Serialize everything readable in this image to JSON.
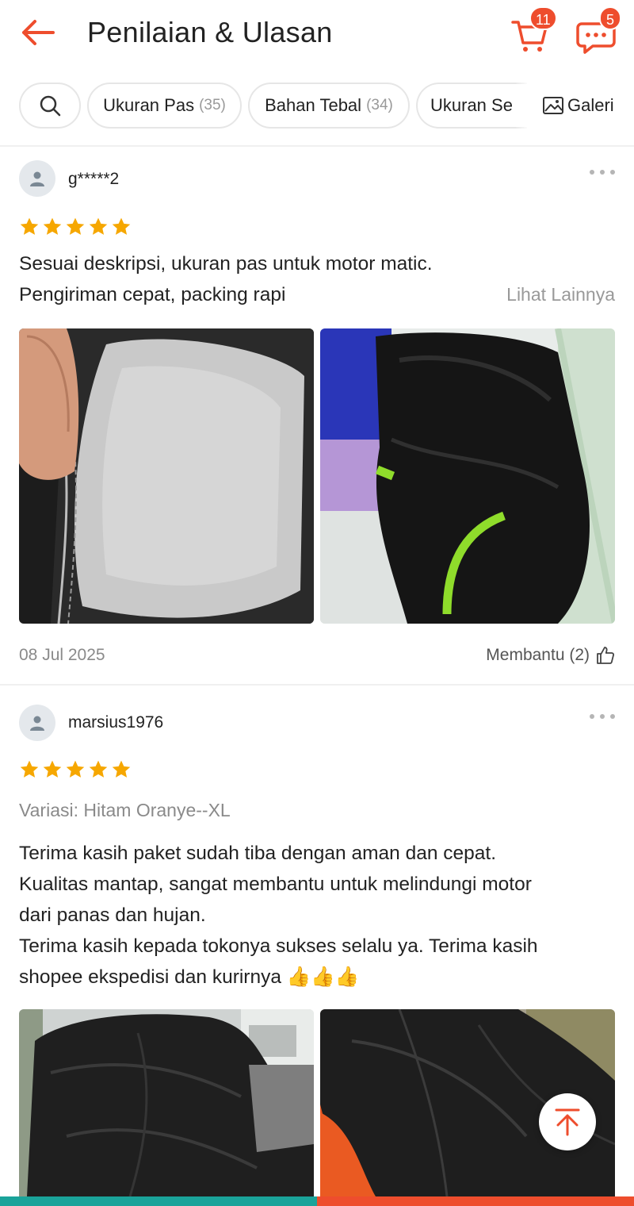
{
  "header": {
    "title": "Penilaian & Ulasan",
    "cart_badge": "11",
    "chat_badge": "5",
    "icons": [
      "back-arrow-icon",
      "cart-icon",
      "chat-icon"
    ],
    "accent_color": "#ee4d2d"
  },
  "filters": {
    "chips": [
      {
        "label": "Ukuran Pas",
        "count": "(35)"
      },
      {
        "label": "Bahan Tebal",
        "count": "(34)"
      },
      {
        "label": "Ukuran Se",
        "count": ""
      }
    ],
    "gallery_label": "Galeri"
  },
  "reviews": [
    {
      "username": "g*****2",
      "rating": 5,
      "variation": "",
      "text": "Sesuai deskripsi, ukuran pas untuk motor matic. Pengiriman cepat, packing rapi",
      "see_more": "Lihat Lainnya",
      "date": "08 Jul 2025",
      "helpful": "Membantu (2)"
    },
    {
      "username": "marsius1976",
      "rating": 5,
      "variation": "Variasi: Hitam Oranye--XL",
      "text_lines": [
        "Terima kasih paket sudah tiba dengan aman dan cepat.",
        "Kualitas mantap, sangat membantu untuk melindungi motor",
        "dari panas dan hujan.",
        "Terima kasih kepada tokonya sukses selalu ya. Terima kasih",
        "shopee ekspedisi dan kurirnya 👍👍👍"
      ]
    }
  ]
}
